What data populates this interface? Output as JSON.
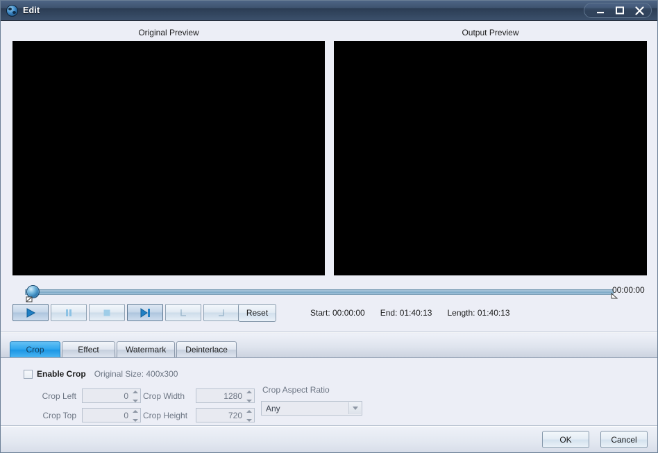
{
  "window": {
    "title": "Edit",
    "icon": "film-reel-icon",
    "controls": {
      "minimize": "minimize-icon",
      "maximize": "maximize-icon",
      "close": "close-icon"
    }
  },
  "previews": {
    "original_label": "Original Preview",
    "output_label": "Output Preview"
  },
  "timeline": {
    "current_time": "00:00:00",
    "thumb_position_percent": 0,
    "start_marker_percent": 0,
    "end_marker_percent": 100
  },
  "transport": {
    "buttons": [
      {
        "name": "play-button",
        "icon": "play-icon",
        "state": "active"
      },
      {
        "name": "pause-button",
        "icon": "pause-icon",
        "state": "normal"
      },
      {
        "name": "stop-button",
        "icon": "stop-icon",
        "state": "normal"
      },
      {
        "name": "next-frame-button",
        "icon": "next-frame-icon",
        "state": "active"
      },
      {
        "name": "set-start-button",
        "icon": "set-start-bracket-icon",
        "state": "dim"
      },
      {
        "name": "set-end-button",
        "icon": "set-end-bracket-icon",
        "state": "dim"
      }
    ],
    "reset_label": "Reset"
  },
  "times": {
    "start": "Start: 00:00:00",
    "end": "End: 01:40:13",
    "length": "Length: 01:40:13"
  },
  "tabs": [
    {
      "label": "Crop",
      "selected": true
    },
    {
      "label": "Effect",
      "selected": false
    },
    {
      "label": "Watermark",
      "selected": false
    },
    {
      "label": "Deinterlace",
      "selected": false
    }
  ],
  "crop_panel": {
    "enable_crop_label": "Enable Crop",
    "enable_crop_checked": false,
    "original_size_label": "Original Size: 400x300",
    "fields": {
      "crop_left": {
        "label": "Crop Left",
        "value": "0"
      },
      "crop_top": {
        "label": "Crop Top",
        "value": "0"
      },
      "crop_width": {
        "label": "Crop Width",
        "value": "1280"
      },
      "crop_height": {
        "label": "Crop Height",
        "value": "720"
      }
    },
    "aspect_ratio": {
      "label": "Crop Aspect Ratio",
      "value": "Any"
    }
  },
  "footer": {
    "ok_label": "OK",
    "cancel_label": "Cancel"
  },
  "colors": {
    "titlebar": "#3e536f",
    "accent_tab": "#2fa6ee",
    "panel_bg": "#eceef6",
    "video_bg": "#000000"
  }
}
